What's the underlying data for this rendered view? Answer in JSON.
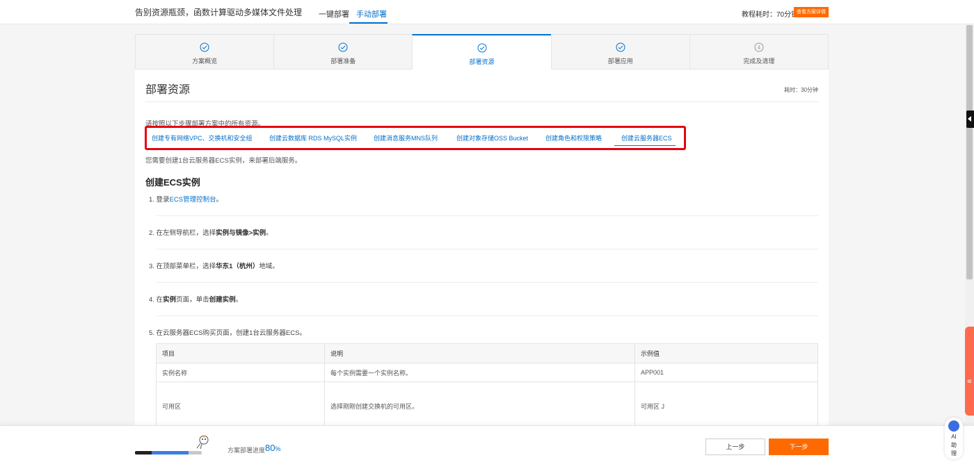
{
  "header": {
    "title": "告别资源瓶颈，函数计算驱动多媒体文件处理",
    "tabs": [
      "一键部署",
      "手动部署"
    ],
    "active_tab": "手动部署",
    "tutorial_time": "教程耗时：70分钟",
    "detail_button": "查看方案详情"
  },
  "steps": [
    {
      "label": "方案概览",
      "state": "done"
    },
    {
      "label": "部署准备",
      "state": "done"
    },
    {
      "label": "部署资源",
      "state": "active"
    },
    {
      "label": "部署应用",
      "state": "done"
    },
    {
      "label": "完成及清理",
      "state": "pending",
      "number": "4"
    }
  ],
  "content": {
    "heading": "部署资源",
    "duration": "耗时：30分钟",
    "intro": "请按照以下步骤部署方案中的所有资源。",
    "links": [
      "创建专有网络VPC、交换机和安全组",
      "创建云数据库 RDS MySQL实例",
      "创建消息服务MNS队列",
      "创建对象存储OSS Bucket",
      "创建角色和权限策略",
      "创建云服务器ECS"
    ],
    "note": "您需要创建1台云服务器ECS实例，来部署后端服务。",
    "section_title": "创建ECS实例",
    "step1": {
      "prefix": "1. 登录",
      "link": "ECS管理控制台",
      "suffix": "。"
    },
    "step2": {
      "prefix": "2. 在左侧导航栏，选择",
      "bold": "实例与镜像>实例",
      "suffix": "。"
    },
    "step3": {
      "prefix": "3. 在顶部菜单栏，选择",
      "bold": "华东1（杭州）",
      "suffix": "地域。"
    },
    "step4": {
      "prefix": "4. 在",
      "bold1": "实例",
      "mid": "页面，单击",
      "bold2": "创建实例",
      "suffix": "。"
    },
    "step5": "5. 在云服务器ECS购买页面，创建1台云服务器ECS。",
    "table": {
      "headers": [
        "项目",
        "说明",
        "示例值"
      ],
      "rows": [
        [
          "实例名称",
          "每个实例需要一个实例名称。",
          "APP001"
        ],
        [
          "可用区",
          "选择刚刚创建交换机的可用区。",
          "可用区 J"
        ]
      ]
    }
  },
  "footer": {
    "progress_label": "方案部署进度",
    "progress_value": "80",
    "progress_unit": "%",
    "progress_fraction": 0.8,
    "prev_button": "上一步",
    "next_button": "下一步"
  },
  "side": {
    "tab_glyph": "«",
    "ai_label": [
      "AI",
      "助",
      "理"
    ]
  },
  "colors": {
    "accent": "#0070cc",
    "brand_orange": "#ff6a00",
    "highlight_red": "#e60012"
  }
}
